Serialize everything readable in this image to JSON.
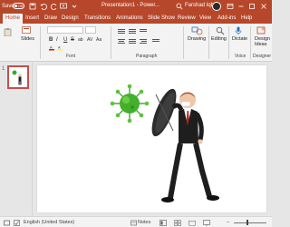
{
  "titlebar": {
    "autosave_label": "Save",
    "toggle_label": "Off",
    "doc_title": "Presentation1 - Power...",
    "user_name": "Farshad Iqbal"
  },
  "tabs": [
    "Home",
    "Insert",
    "Draw",
    "Design",
    "Transitions",
    "Animations",
    "Slide Show",
    "Review",
    "View",
    "Add-ins",
    "Help"
  ],
  "active_tab": "Home",
  "ribbon": {
    "slides_label": "Slides",
    "drawing_label": "Drawing",
    "editing_label": "Editing",
    "dictate_label": "Dictate",
    "design_ideas_label": "Design Ideas",
    "format_buttons": [
      "B",
      "I",
      "U",
      "S",
      "ab",
      "AV",
      "Aa"
    ],
    "groups": {
      "font": "Font",
      "paragraph": "Paragraph",
      "voice": "Voice",
      "designer": "Designer"
    }
  },
  "thumbnails": {
    "slide_number": "1"
  },
  "statusbar": {
    "language": "English (United States)",
    "notes_label": "Notes"
  },
  "colors": {
    "brand": "#b7472a",
    "ribbon_bg": "#f3f3f3",
    "workspace_bg": "#e6e6e6"
  }
}
